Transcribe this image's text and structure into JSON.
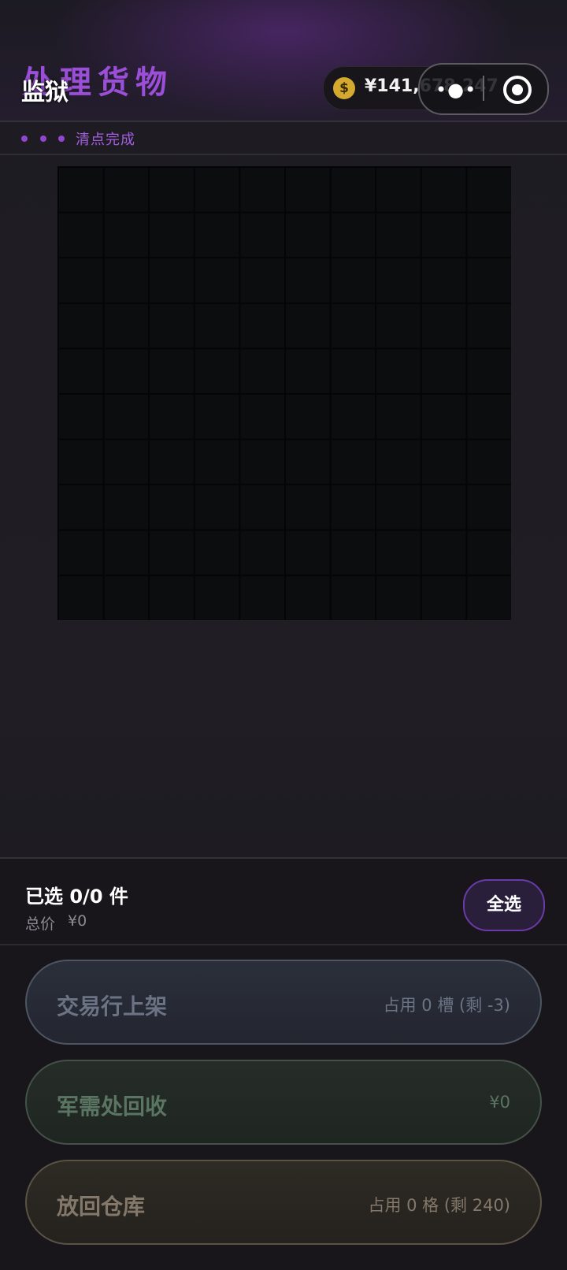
{
  "header": {
    "title_large": "处理货物",
    "title_small": "监狱",
    "money": "¥141,678,247",
    "coin_symbol": "$"
  },
  "capsule": {
    "more_glyph": "•●•"
  },
  "status": {
    "text": "清点完成"
  },
  "grid": {
    "rows": 10,
    "cols": 10
  },
  "selection": {
    "selected_label": "已选 0/0 件",
    "total_label": "总价",
    "total_value": "¥0",
    "select_all": "全选"
  },
  "actions": {
    "market": {
      "label": "交易行上架",
      "info": "占用 0 槽 (剩 -3)"
    },
    "recycle": {
      "label": "军需处回收",
      "info": "¥0"
    },
    "return": {
      "label": "放回仓库",
      "info": "占用 0 格 (剩 240)"
    }
  },
  "colors": {
    "accent_purple": "#9b4fd9",
    "coin_gold": "#d4a92f"
  }
}
